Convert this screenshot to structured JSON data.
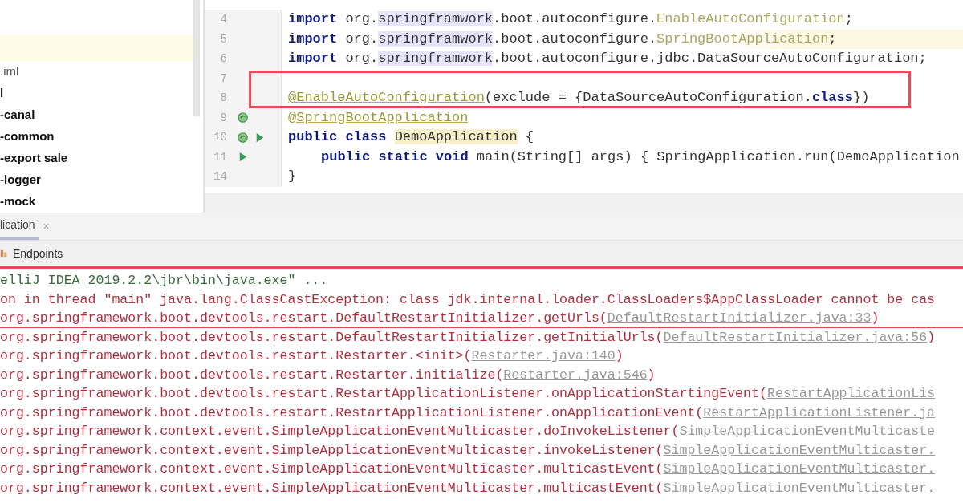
{
  "project_tree": {
    "items": [
      {
        "label": ".iml",
        "kind": "file"
      },
      {
        "label": "l",
        "kind": "module"
      },
      {
        "label": "-canal",
        "kind": "module"
      },
      {
        "label": "-common",
        "kind": "module"
      },
      {
        "label": "-export sale",
        "kind": "module"
      },
      {
        "label": "-logger",
        "kind": "module"
      },
      {
        "label": "-mock",
        "kind": "module"
      }
    ]
  },
  "editor": {
    "lines": [
      {
        "number": "4",
        "tokens": [
          {
            "kind": "kw",
            "text": "import"
          },
          {
            "kind": "plain",
            "text": " org."
          },
          {
            "kind": "marked",
            "text": "springframwork"
          },
          {
            "kind": "plain",
            "text": ".boot.autoconfigure."
          },
          {
            "kind": "dim",
            "text": "EnableAutoConfiguration"
          },
          {
            "kind": "plain",
            "text": ";"
          }
        ]
      },
      {
        "number": "5",
        "current": true,
        "tokens": [
          {
            "kind": "kw",
            "text": "import"
          },
          {
            "kind": "plain",
            "text": " org."
          },
          {
            "kind": "marked",
            "text": "springframwork"
          },
          {
            "kind": "plain",
            "text": ".boot.autoconfigure."
          },
          {
            "kind": "dim",
            "text": "SpringBootApplication"
          },
          {
            "kind": "plain",
            "text": ";"
          }
        ]
      },
      {
        "number": "6",
        "tokens": [
          {
            "kind": "kw",
            "text": "import"
          },
          {
            "kind": "plain",
            "text": " org."
          },
          {
            "kind": "marked",
            "text": "springframwork"
          },
          {
            "kind": "plain",
            "text": ".boot.autoconfigure.jdbc.DataSourceAutoConfiguration;"
          }
        ]
      },
      {
        "number": "7"
      },
      {
        "number": "8",
        "tokens": [
          {
            "kind": "annotation",
            "text": "@EnableAutoConfiguration"
          },
          {
            "kind": "plain",
            "text": "(exclude = {DataSourceAutoConfiguration."
          },
          {
            "kind": "kw",
            "text": "class"
          },
          {
            "kind": "plain",
            "text": "})"
          }
        ]
      },
      {
        "number": "9",
        "bean": true,
        "tokens": [
          {
            "kind": "annotation",
            "text": "@SpringBootApplication"
          }
        ]
      },
      {
        "number": "10",
        "bean": true,
        "run": true,
        "tokens": [
          {
            "kind": "kw",
            "text": "public class "
          },
          {
            "kind": "highlight",
            "text": "DemoApplication"
          },
          {
            "kind": "plain",
            "text": " {"
          }
        ]
      },
      {
        "number": "11",
        "run": true,
        "indented": true,
        "tokens": [
          {
            "kind": "kw",
            "text": "public static void "
          },
          {
            "kind": "plain",
            "text": "main(String[] args) { SpringApplication.run(DemoApplication"
          }
        ]
      },
      {
        "number": "14",
        "tokens": [
          {
            "kind": "plain",
            "text": "}"
          }
        ]
      }
    ]
  },
  "run_tab": {
    "label": "lication",
    "close": "×"
  },
  "endpoints_tab": {
    "label": "Endpoints"
  },
  "console": {
    "lines": [
      {
        "kind": "command",
        "text": "elliJ IDEA 2019.2.2\\jbr\\bin\\java.exe\" ..."
      },
      {
        "kind": "error",
        "text": "on in thread \"main\" java.lang.ClassCastException: class jdk.internal.loader.ClassLoaders$AppClassLoader cannot be cas"
      },
      {
        "kind": "frame",
        "struck": true,
        "text": "org.springframework.boot.devtools.restart.DefaultRestartInitializer.getUrls(",
        "link": "DefaultRestartInitializer.java:33",
        "tail": ")"
      },
      {
        "kind": "frame",
        "struck": false,
        "text": "org.springframework.boot.devtools.restart.DefaultRestartInitializer.getInitialUrls(",
        "link": "DefaultRestartInitializer.java:56",
        "tail": ")"
      },
      {
        "kind": "frame",
        "struck": false,
        "text": "org.springframework.boot.devtools.restart.Restarter.<init>(",
        "link": "Restarter.java:140",
        "tail": ")"
      },
      {
        "kind": "frame",
        "struck": false,
        "text": "org.springframework.boot.devtools.restart.Restarter.initialize(",
        "link": "Restarter.java:546",
        "tail": ")"
      },
      {
        "kind": "frame",
        "struck": false,
        "text": "org.springframework.boot.devtools.restart.RestartApplicationListener.onApplicationStartingEvent(",
        "link": "RestartApplicationLis"
      },
      {
        "kind": "frame",
        "struck": false,
        "text": "org.springframework.boot.devtools.restart.RestartApplicationListener.onApplicationEvent(",
        "link": "RestartApplicationListener.ja"
      },
      {
        "kind": "frame",
        "struck": false,
        "text": "org.springframework.context.event.SimpleApplicationEventMulticaster.doInvokeListener(",
        "link": "SimpleApplicationEventMulticaste"
      },
      {
        "kind": "frame",
        "struck": false,
        "text": "org.springframework.context.event.SimpleApplicationEventMulticaster.invokeListener(",
        "link": "SimpleApplicationEventMulticaster."
      },
      {
        "kind": "frame",
        "struck": false,
        "text": "org.springframework.context.event.SimpleApplicationEventMulticaster.multicastEvent(",
        "link": "SimpleApplicationEventMulticaster."
      },
      {
        "kind": "frame",
        "struck": false,
        "text": "org.springframework.context.event.SimpleApplicationEventMulticaster.multicastEvent(",
        "link": "SimpleApplicationEventMulticaster."
      }
    ]
  }
}
